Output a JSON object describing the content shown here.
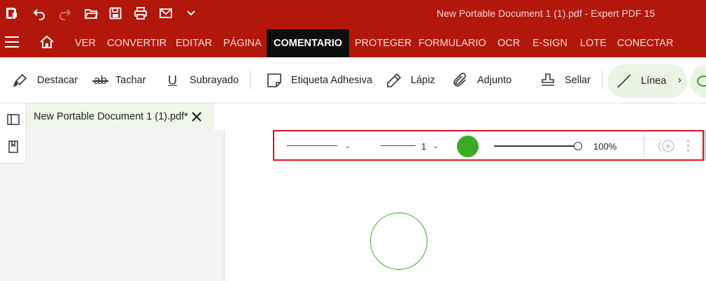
{
  "window": {
    "title": "New Portable Document 1 (1).pdf   -   Expert PDF 15"
  },
  "quick_access": {
    "icons": [
      "app-logo-icon",
      "undo-icon",
      "redo-icon",
      "open-folder-icon",
      "save-icon",
      "print-icon",
      "email-icon",
      "chevron-down-icon"
    ]
  },
  "menu": {
    "items": [
      "VER",
      "CONVERTIR",
      "EDITAR",
      "PÁGINA",
      "COMENTARIO",
      "PROTEGER",
      "FORMULARIO",
      "OCR",
      "E-SIGN",
      "LOTE",
      "CONECTAR"
    ],
    "active": "COMENTARIO"
  },
  "tools": {
    "destacar": "Destacar",
    "tachar": "Tachar",
    "subrayado": "Subrayado",
    "etiqueta": "Etiqueta Adhesiva",
    "lapiz": "Lápiz",
    "adjunto": "Adjunto",
    "sellar": "Sellar",
    "linea": "Línea",
    "subrayado_glyph": "U",
    "tachar_glyph": "ab"
  },
  "document_tab": {
    "label": "New Portable Document 1 (1).pdf*"
  },
  "property_bar": {
    "line_width_value": "1",
    "color": "#3aab25",
    "opacity": "100%",
    "opacity_fraction": 1.0
  },
  "colors": {
    "brand_red": "#b3160b",
    "active_tab": "#0d0d0d",
    "accent_green": "#3aab25",
    "highlight_border": "#e0131a"
  }
}
